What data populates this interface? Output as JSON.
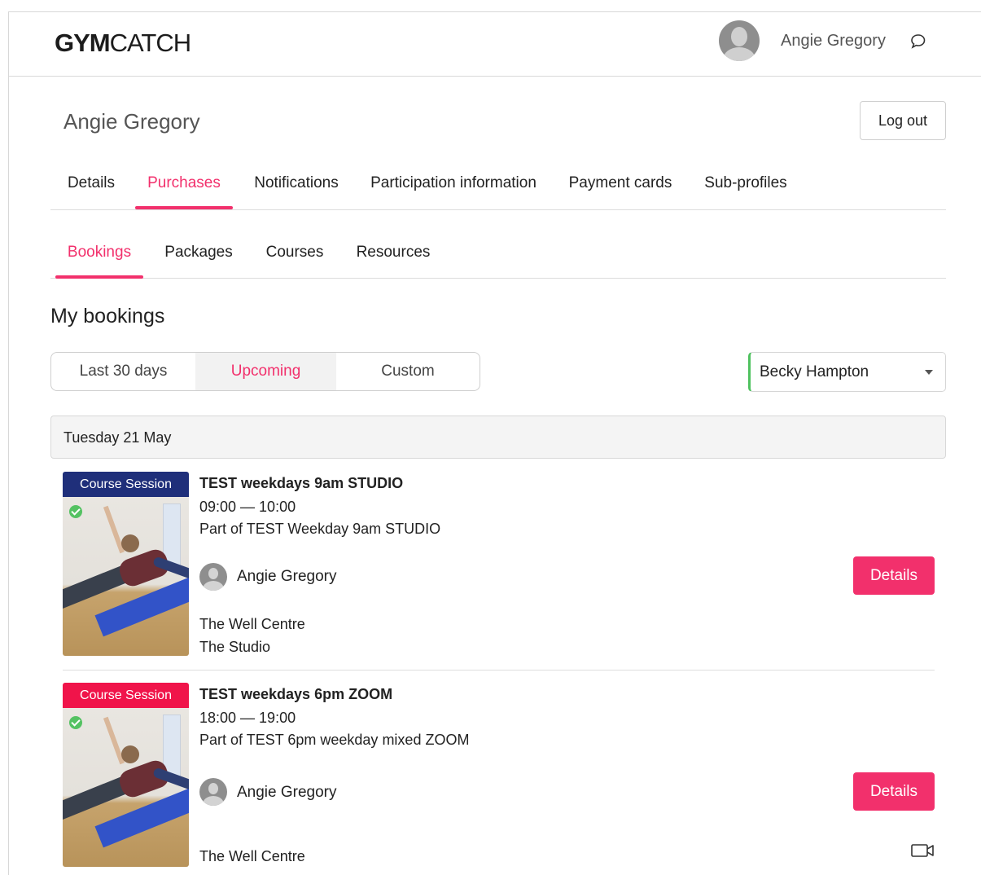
{
  "brand": {
    "logo_bold": "GYM",
    "logo_thin": "CATCH"
  },
  "header": {
    "username": "Angie Gregory",
    "chat_icon": "chat-bubble-icon",
    "avatar_icon": "user-avatar-icon"
  },
  "profile": {
    "name": "Angie Gregory",
    "logout_label": "Log out"
  },
  "main_tabs": [
    {
      "label": "Details",
      "active": false
    },
    {
      "label": "Purchases",
      "active": true
    },
    {
      "label": "Notifications",
      "active": false
    },
    {
      "label": "Participation information",
      "active": false
    },
    {
      "label": "Payment cards",
      "active": false
    },
    {
      "label": "Sub-profiles",
      "active": false
    }
  ],
  "sub_tabs": [
    {
      "label": "Bookings",
      "active": true
    },
    {
      "label": "Packages",
      "active": false
    },
    {
      "label": "Courses",
      "active": false
    },
    {
      "label": "Resources",
      "active": false
    }
  ],
  "section_title": "My bookings",
  "range_filter": {
    "options": [
      "Last 30 days",
      "Upcoming",
      "Custom"
    ],
    "selected": "Upcoming"
  },
  "member_select": {
    "value": "Becky Hampton"
  },
  "date_header": "Tuesday 21 May",
  "bookings": [
    {
      "badge": "Course Session",
      "badge_color": "#1f2f7a",
      "title": "TEST weekdays 9am STUDIO",
      "time": "09:00 — 10:00",
      "part_of": "Part of TEST Weekday 9am STUDIO",
      "person": "Angie Gregory",
      "venue": "The Well Centre",
      "room": "The Studio",
      "details_label": "Details"
    },
    {
      "badge": "Course Session",
      "badge_color": "#f0144a",
      "title": "TEST weekdays 6pm ZOOM",
      "time": "18:00 — 19:00",
      "part_of": "Part of TEST 6pm weekday mixed ZOOM",
      "person": "Angie Gregory",
      "venue": "The Well Centre",
      "details_label": "Details",
      "online_icon": "video-camera-icon"
    }
  ],
  "colors": {
    "accent": "#f2306c",
    "select_border": "#4fc25f",
    "check": "#54c262"
  }
}
